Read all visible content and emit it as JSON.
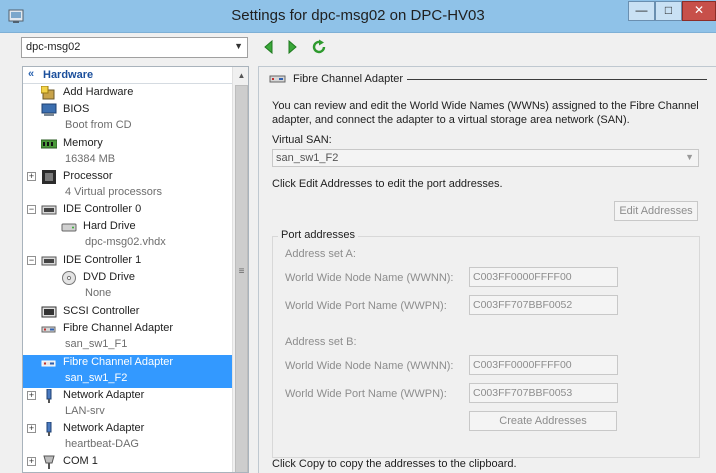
{
  "window": {
    "title": "Settings for dpc-msg02 on DPC-HV03",
    "minimize_glyph": "—",
    "maximize_glyph": "□",
    "close_glyph": "✕"
  },
  "toolbar": {
    "vm_select_value": "dpc-msg02",
    "back_icon": "green-left-triangle",
    "forward_icon": "green-right-triangle",
    "refresh_icon": "green-circular-refresh-arrow"
  },
  "tree": {
    "section": "Hardware",
    "items": [
      {
        "label": "Add Hardware",
        "sub": "",
        "icon": "add-hardware-icon"
      },
      {
        "label": "BIOS",
        "sub": "Boot from CD",
        "icon": "bios-icon"
      },
      {
        "label": "Memory",
        "sub": "16384 MB",
        "icon": "memory-icon"
      },
      {
        "label": "Processor",
        "sub": "4 Virtual processors",
        "icon": "processor-icon"
      },
      {
        "label": "IDE Controller 0",
        "sub": "",
        "icon": "ide-controller-icon"
      },
      {
        "label": "Hard Drive",
        "sub": "dpc-msg02.vhdx",
        "icon": "hard-drive-icon"
      },
      {
        "label": "IDE Controller 1",
        "sub": "",
        "icon": "ide-controller-icon"
      },
      {
        "label": "DVD Drive",
        "sub": "None",
        "icon": "dvd-drive-icon"
      },
      {
        "label": "SCSI Controller",
        "sub": "",
        "icon": "scsi-controller-icon"
      },
      {
        "label": "Fibre Channel Adapter",
        "sub": "san_sw1_F1",
        "icon": "fibre-channel-icon"
      },
      {
        "label": "Fibre Channel Adapter",
        "sub": "san_sw1_F2",
        "icon": "fibre-channel-icon",
        "selected": true
      },
      {
        "label": "Network Adapter",
        "sub": "LAN-srv",
        "icon": "network-adapter-icon"
      },
      {
        "label": "Network Adapter",
        "sub": "heartbeat-DAG",
        "icon": "network-adapter-icon"
      },
      {
        "label": "COM 1",
        "sub": "",
        "icon": "com-port-icon"
      }
    ],
    "expanders": [
      "+",
      "−",
      "−",
      "+",
      "+",
      "+"
    ]
  },
  "detail": {
    "section_title": "Fibre Channel Adapter",
    "description": "You can review and edit the World Wide Names (WWNs) assigned to the Fibre Channel adapter, and connect the adapter to a virtual storage area network (SAN).",
    "virtual_san_label": "Virtual SAN:",
    "virtual_san_value": "san_sw1_F2",
    "edit_hint": "Click Edit Addresses to edit the port addresses.",
    "edit_button": "Edit Addresses",
    "port_addresses_title": "Port addresses",
    "set_a_label": "Address set A:",
    "set_a_wwnn_label": "World Wide Node Name (WWNN):",
    "set_a_wwnn": "C003FF0000FFFF00",
    "set_a_wwpn_label": "World Wide Port Name (WWPN):",
    "set_a_wwpn": "C003FF707BBF0052",
    "set_b_label": "Address set B:",
    "set_b_wwnn_label": "World Wide Node Name (WWNN):",
    "set_b_wwnn": "C003FF0000FFFF00",
    "set_b_wwpn_label": "World Wide Port Name (WWPN):",
    "set_b_wwpn": "C003FF707BBF0053",
    "create_button": "Create Addresses",
    "copy_hint": "Click Copy to copy the addresses to the clipboard."
  },
  "colors": {
    "titlebar": "#8fc2e8",
    "selection": "#3399ff",
    "hardware_header": "#1b4f9c",
    "close_button": "#c7504a"
  }
}
